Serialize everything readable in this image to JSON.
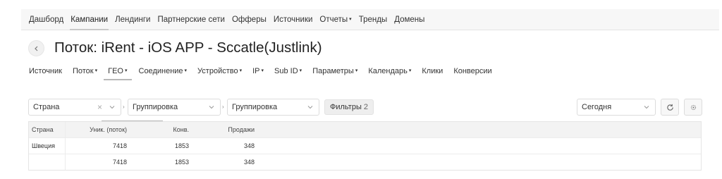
{
  "topnav": {
    "items": [
      {
        "label": "Дашборд",
        "dropdown": false,
        "active": false
      },
      {
        "label": "Кампании",
        "dropdown": false,
        "active": true
      },
      {
        "label": "Лендинги",
        "dropdown": false,
        "active": false
      },
      {
        "label": "Партнерские сети",
        "dropdown": false,
        "active": false
      },
      {
        "label": "Офферы",
        "dropdown": false,
        "active": false
      },
      {
        "label": "Источники",
        "dropdown": false,
        "active": false
      },
      {
        "label": "Отчеты",
        "dropdown": true,
        "active": false
      },
      {
        "label": "Тренды",
        "dropdown": false,
        "active": false
      },
      {
        "label": "Домены",
        "dropdown": false,
        "active": false
      }
    ]
  },
  "page": {
    "title": "Поток: iRent - iOS APP - Sccatle(Justlink)"
  },
  "subnav": {
    "items": [
      {
        "label": "Источник",
        "dropdown": false,
        "active": false
      },
      {
        "label": "Поток",
        "dropdown": true,
        "active": false
      },
      {
        "label": "ГЕО",
        "dropdown": true,
        "active": true
      },
      {
        "label": "Соединение",
        "dropdown": true,
        "active": false
      },
      {
        "label": "Устройство",
        "dropdown": true,
        "active": false
      },
      {
        "label": "IP",
        "dropdown": true,
        "active": false
      },
      {
        "label": "Sub ID",
        "dropdown": true,
        "active": false
      },
      {
        "label": "Параметры",
        "dropdown": true,
        "active": false
      },
      {
        "label": "Календарь",
        "dropdown": true,
        "active": false
      },
      {
        "label": "Клики",
        "dropdown": false,
        "active": false
      },
      {
        "label": "Конверсии",
        "dropdown": false,
        "active": false
      }
    ]
  },
  "filters": {
    "group1_value": "Страна",
    "group2_placeholder": "Группировка",
    "group3_placeholder": "Группировка",
    "filters_label": "Фильтры",
    "filters_count": "2",
    "date_value": "Сегодня"
  },
  "table": {
    "headers": [
      "Страна",
      "Уник. (поток)",
      "Конв.",
      "Продажи"
    ],
    "rows": [
      [
        "Швеция",
        "7418",
        "1853",
        "348"
      ],
      [
        "",
        "7418",
        "1853",
        "348"
      ]
    ]
  },
  "icons": {
    "back": "chevron-left-icon",
    "clear": "clear-icon",
    "dropdown": "chevron-down-icon",
    "separator": "chevron-right-icon",
    "refresh": "refresh-icon",
    "settings": "gear-icon"
  }
}
